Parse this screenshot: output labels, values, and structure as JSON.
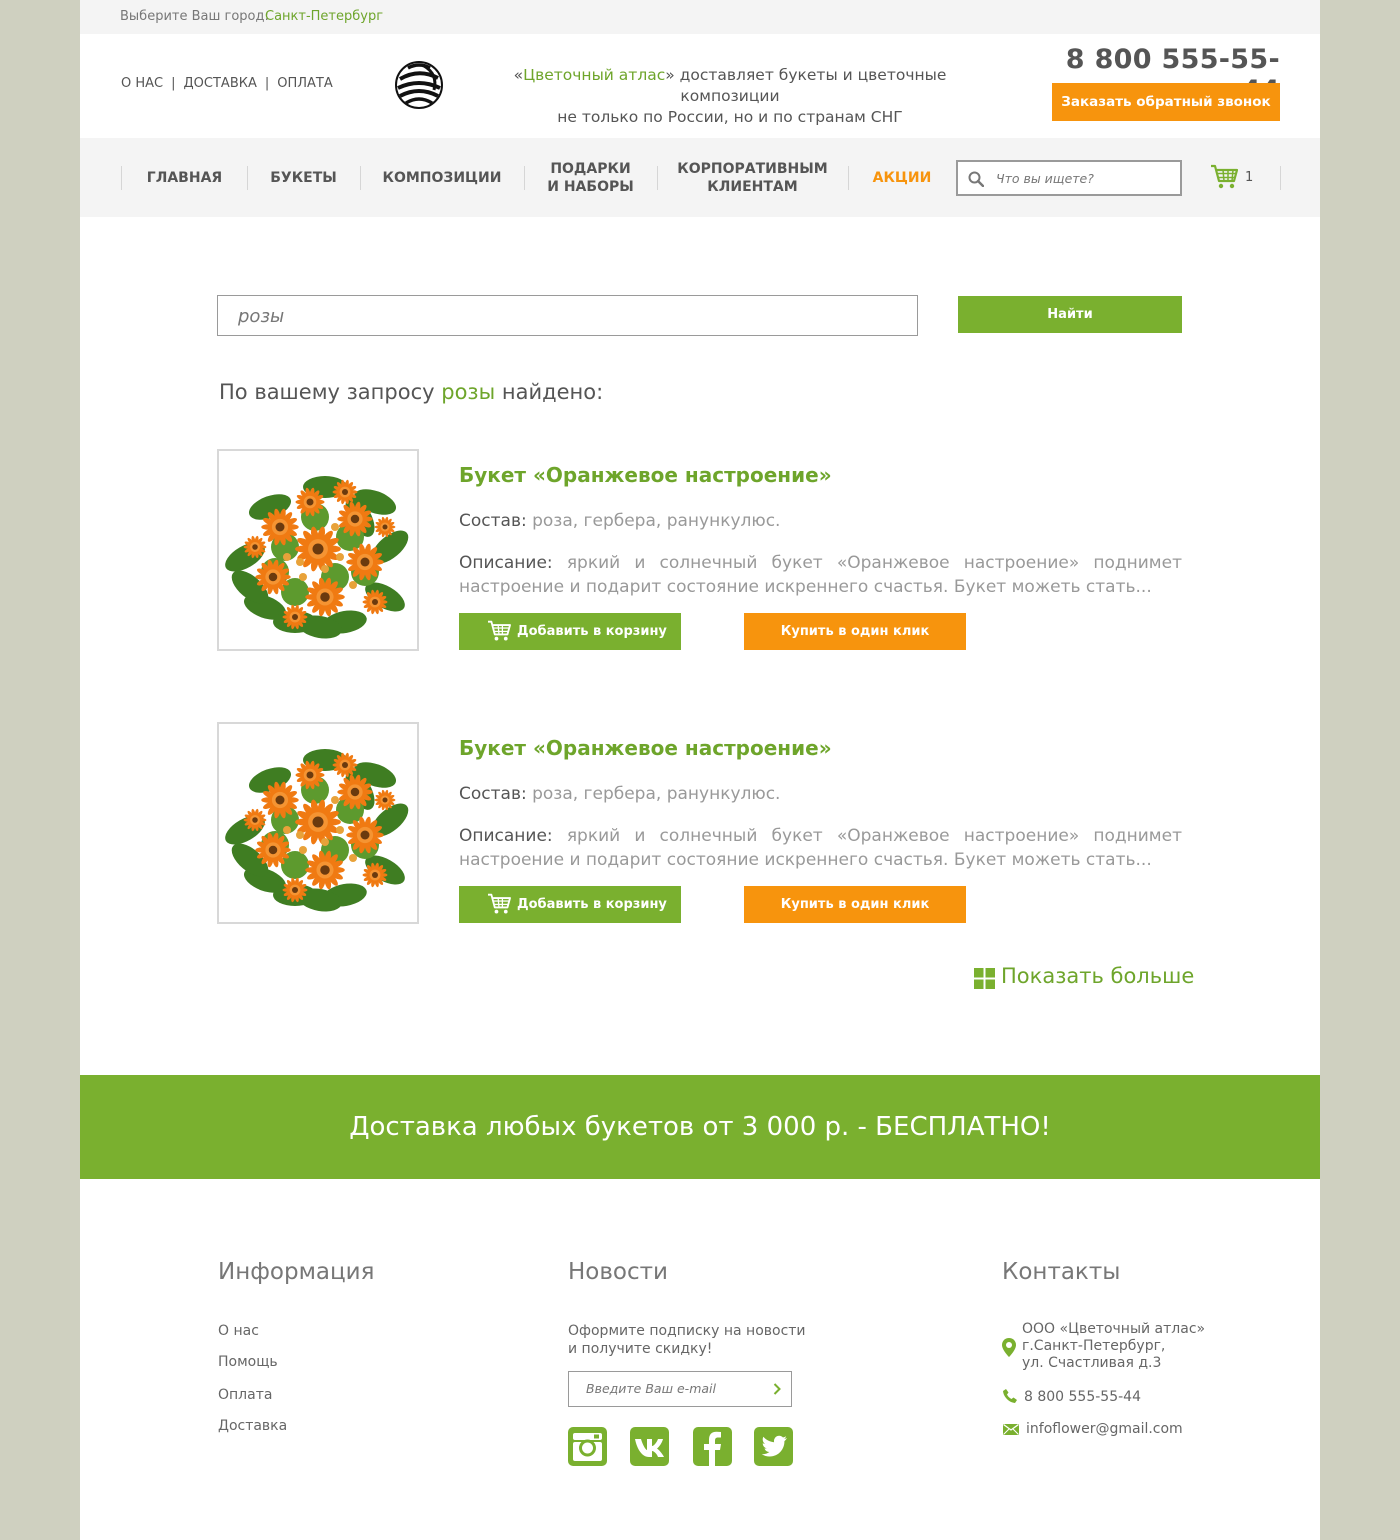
{
  "city": {
    "label": "Выберите Ваш город:",
    "value": "Санкт-Петербург"
  },
  "header": {
    "links": [
      "О НАС",
      "ДОСТАВКА",
      "ОПЛАТА"
    ],
    "separator": "|",
    "tagline": {
      "quote_open": "«",
      "brand": "Цветочный атлас",
      "line1_rest": "» доставляет букеты и цветочные композиции",
      "line2": "не только по России, но и по странам СНГ"
    },
    "phone": "8 800 555-55-44",
    "callback_label": "Заказать обратный звонок"
  },
  "nav": {
    "items": [
      {
        "line1": "ГЛАВНАЯ",
        "line2": ""
      },
      {
        "line1": "БУКЕТЫ",
        "line2": ""
      },
      {
        "line1": "КОМПОЗИЦИИ",
        "line2": ""
      },
      {
        "line1": "ПОДАРКИ",
        "line2": "И НАБОРЫ"
      },
      {
        "line1": "КОРПОРАТИВНЫМ",
        "line2": "КЛИЕНТАМ"
      },
      {
        "line1": "АКЦИИ",
        "line2": ""
      }
    ],
    "search_placeholder": "Что вы ищете?",
    "cart_count": "1"
  },
  "search": {
    "query": "розы",
    "button_label": "Найти",
    "result_prefix": "По вашему запросу",
    "result_query": "розы",
    "result_suffix": "найдено:"
  },
  "products": [
    {
      "title": "Букет «Оранжевое настроение»",
      "composition_label": "Состав:",
      "composition": "роза, гербера, ранункулюс.",
      "description_label": "Описание:",
      "description": "яркий и солнечный букет «Оранжевое настроение» поднимет настроение и подарит состояние искреннего счастья. Букет можеть стать...",
      "add_label": "Добавить в корзину",
      "buy_label": "Купить в один клик"
    },
    {
      "title": "Букет «Оранжевое настроение»",
      "composition_label": "Состав:",
      "composition": "роза, гербера, ранункулюс.",
      "description_label": "Описание:",
      "description": "яркий и солнечный букет «Оранжевое настроение» поднимет настроение и подарит состояние искреннего счастья. Букет можеть стать...",
      "add_label": "Добавить в корзину",
      "buy_label": "Купить в один клик"
    }
  ],
  "show_more": "Показать больше",
  "banner": "Доставка любых букетов от 3 000 р. - БЕСПЛАТНО!",
  "footer": {
    "info": {
      "title": "Информация",
      "links": [
        "О нас",
        "Помощь",
        "Оплата",
        "Доставка"
      ]
    },
    "news": {
      "title": "Новости",
      "text": "Оформите подписку на новости и получите скидку!",
      "email_placeholder": "Введите Ваш e-mail",
      "social": [
        "instagram-icon",
        "vk-icon",
        "facebook-icon",
        "twitter-icon"
      ]
    },
    "contacts": {
      "title": "Контакты",
      "company": "ООО «Цветочный атлас»",
      "city": "г.Санкт-Петербург,",
      "street": "ул. Счастливая д.3",
      "phone": "8 800 555-55-44",
      "email": "infoflower@gmail.com"
    }
  },
  "colors": {
    "green": "#7ab02f",
    "green_text": "#6ea52b",
    "orange": "#f7940d",
    "page_bg": "#cfd0c0"
  }
}
